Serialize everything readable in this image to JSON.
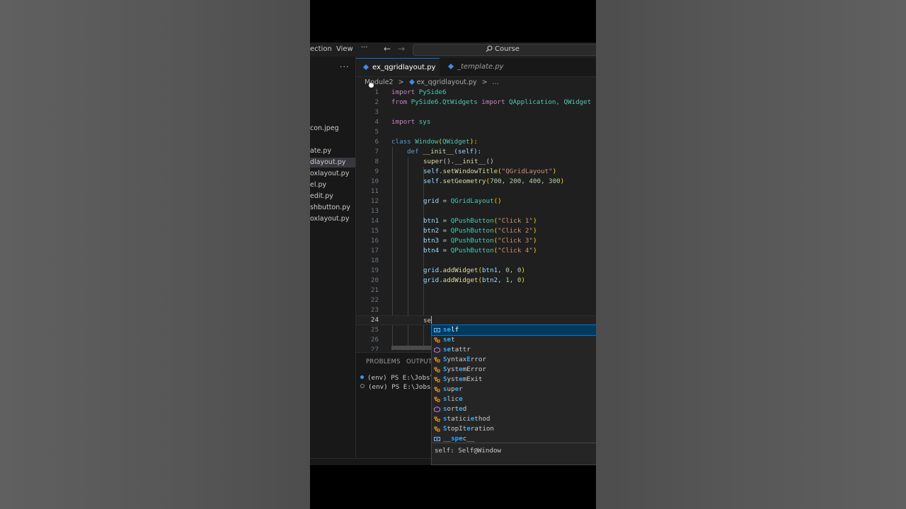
{
  "titlebar": {
    "menu": [
      "ection",
      "View"
    ],
    "more_label": "···",
    "search_label": "Course"
  },
  "explorer": {
    "more_label": "···",
    "files": [
      "con.jpeg",
      "ate.py",
      "dlayout.py",
      "oxlayout.py",
      "el.py",
      "edit.py",
      "shbutton.py",
      "oxlayout.py"
    ],
    "selected_index": 2
  },
  "tabs": [
    {
      "label": "ex_qgridlayout.py",
      "active": true,
      "dirty": true
    },
    {
      "label": "_template.py",
      "active": false,
      "dirty": false
    }
  ],
  "breadcrumb": [
    "Module2",
    ">",
    "ex_qgridlayout.py",
    ">",
    "..."
  ],
  "editor": {
    "current_line": 24,
    "line_numbers": [
      "1",
      "2",
      "3",
      "4",
      "5",
      "6",
      "7",
      "8",
      "9",
      "10",
      "11",
      "12",
      "13",
      "14",
      "15",
      "16",
      "17",
      "18",
      "19",
      "20",
      "21",
      "22",
      "23",
      "24",
      "25",
      "26",
      "27"
    ],
    "line1": {
      "kw": "import",
      "mod": "PySide6"
    },
    "line2": {
      "kw": "from",
      "mod": "PySide6.QtWidgets",
      "kw2": "import",
      "rest": "QApplication, QWidget"
    },
    "line4": {
      "kw": "import",
      "mod": "sys"
    },
    "line6": {
      "kw": "class",
      "cls": "Window",
      "base": "QWidget",
      "p1": "(",
      "p2": "):"
    },
    "line7": {
      "kw": "def",
      "fn": "__init__",
      "args": "(self):"
    },
    "line8": {
      "fn1": "super",
      "p": "().",
      "fn2": "__init__",
      "end": "()"
    },
    "line9": {
      "obj": "self.",
      "fn": "setWindowTitle",
      "p1": "(",
      "str": "\"QGridLayout\"",
      "p2": ")"
    },
    "line10": {
      "obj": "self.",
      "fn": "setGeometry",
      "p1": "(",
      "nums": "700, 200, 400, 300",
      "p2": ")"
    },
    "line12": {
      "var": "grid",
      "eq": " = ",
      "cls": "QGridLayout",
      "end": "()"
    },
    "btn_lines": [
      {
        "var": "btn1",
        "eq": " = ",
        "cls": "QPushButton",
        "p1": "(",
        "str": "\"Click 1\"",
        "p2": ")"
      },
      {
        "var": "btn2",
        "eq": " = ",
        "cls": "QPushButton",
        "p1": "(",
        "str": "\"Click 2\"",
        "p2": ")"
      },
      {
        "var": "btn3",
        "eq": " = ",
        "cls": "QPushButton",
        "p1": "(",
        "str": "\"Click 3\"",
        "p2": ")"
      },
      {
        "var": "btn4",
        "eq": " = ",
        "cls": "QPushButton",
        "p1": "(",
        "str": "\"Click 4\"",
        "p2": ")"
      }
    ],
    "add_lines": [
      {
        "obj": "grid.",
        "fn": "addWidget",
        "p1": "(",
        "var": "btn1",
        "c": ", ",
        "n1": "0",
        "c2": ", ",
        "n2": "0",
        "p2": ")"
      },
      {
        "obj": "grid.",
        "fn": "addWidget",
        "p1": "(",
        "var": "btn2",
        "c": ", ",
        "n1": "1",
        "c2": ", ",
        "n2": "0",
        "p2": ")"
      }
    ],
    "line24": "se"
  },
  "panel": {
    "tabs": [
      "PROBLEMS",
      "OUTPUT"
    ],
    "terminal": [
      "(env) PS E:\\Jobs\\",
      "(env) PS E:\\Jobs\\"
    ]
  },
  "suggestions": {
    "items": [
      {
        "kind": "variable",
        "hl": "se",
        "rest": "lf"
      },
      {
        "kind": "class",
        "hl": "se",
        "rest": "t"
      },
      {
        "kind": "function",
        "hl": "se",
        "rest": "tattr"
      },
      {
        "kind": "class",
        "hl": "S",
        "mid": "yntax",
        "hl2": "E",
        "rest": "rror"
      },
      {
        "kind": "class",
        "hl": "S",
        "mid": "yst",
        "hl2": "e",
        "rest": "mError"
      },
      {
        "kind": "class",
        "hl": "S",
        "mid": "yst",
        "hl2": "e",
        "rest": "mExit"
      },
      {
        "kind": "class",
        "hl": "s",
        "mid": "up",
        "hl2": "e",
        "rest": "r"
      },
      {
        "kind": "class",
        "hl": "s",
        "mid": "lic",
        "hl2": "e",
        "rest": ""
      },
      {
        "kind": "function",
        "hl": "s",
        "mid": "ort",
        "hl2": "e",
        "rest": "d"
      },
      {
        "kind": "class",
        "hl": "s",
        "mid": "tatici",
        "hl2": "e",
        "rest": "thod"
      },
      {
        "kind": "class",
        "hl": "S",
        "mid": "topIt",
        "hl2": "e",
        "rest": "ration"
      },
      {
        "kind": "variable",
        "hl": "",
        "mid": "__",
        "hl2": "spe",
        "rest": "c__"
      }
    ],
    "selected_index": 0,
    "detail": "self: Self@Window"
  },
  "colors": {
    "accent": "#0078d4",
    "python_icon": "#3b8eea",
    "selection": "#04395e"
  }
}
